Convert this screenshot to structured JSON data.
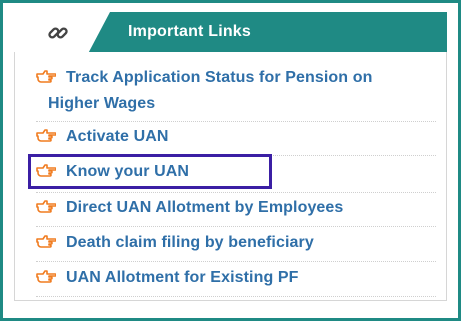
{
  "header": {
    "title": "Important Links",
    "icon": "chain-link-icon",
    "accent": "#1f8a84"
  },
  "links": [
    {
      "line1": "Track Application Status for Pension on",
      "line2": "Higher Wages",
      "icon": "pointing-hand-icon"
    },
    {
      "label": "Activate UAN",
      "icon": "pointing-hand-icon"
    },
    {
      "label": "Know your UAN",
      "icon": "pointing-hand-icon",
      "highlighted": true
    },
    {
      "label": "Direct UAN Allotment by Employees",
      "icon": "pointing-hand-icon"
    },
    {
      "label": "Death claim filing by beneficiary",
      "icon": "pointing-hand-icon"
    },
    {
      "label": "UAN Allotment for Existing PF",
      "icon": "pointing-hand-icon"
    }
  ],
  "colors": {
    "link": "#2f6fa8",
    "hand_icon": "#f07b1f",
    "highlight_border": "#3b1fa4"
  }
}
